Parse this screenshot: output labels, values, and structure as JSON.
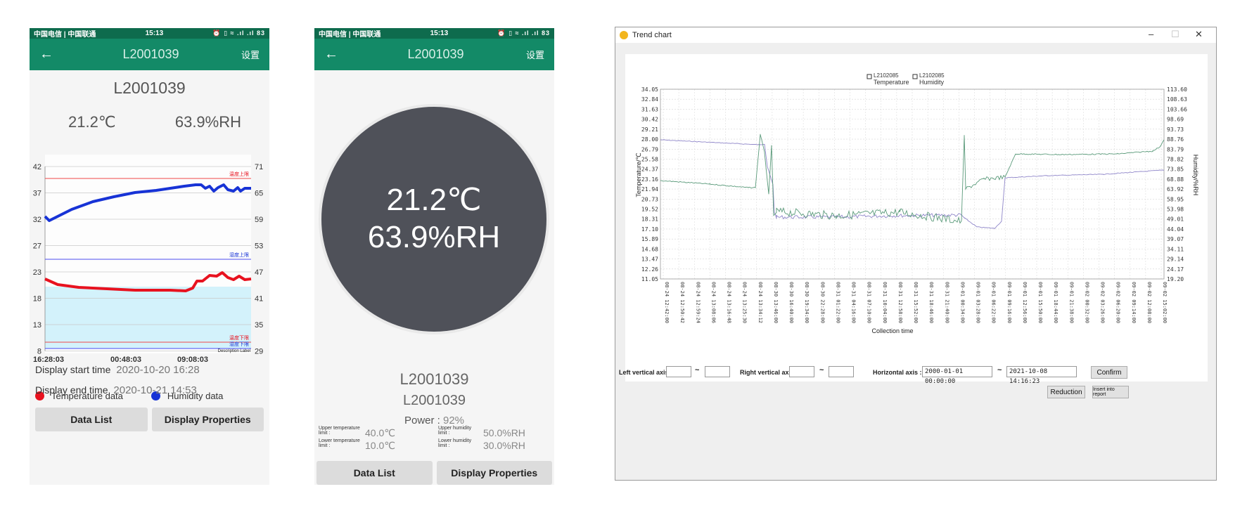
{
  "phone1": {
    "status": {
      "carrier": "中国电信 | 中国联通",
      "time": "15:13",
      "icons": "⏰ ▯ ≈ .ıl .ıl 83"
    },
    "app_bar": {
      "back": "←",
      "title": "L2001039",
      "settings": "设置"
    },
    "device_name": "L2001039",
    "temperature": "21.2℃",
    "humidity": "63.9%RH",
    "chart": {
      "left_ticks": [
        "42",
        "37",
        "32",
        "27",
        "23",
        "18",
        "13",
        "8"
      ],
      "right_ticks": [
        "71",
        "65",
        "59",
        "53",
        "47",
        "41",
        "35",
        "29"
      ],
      "x_ticks": [
        "16:28:03",
        "00:48:03",
        "09:08:03"
      ],
      "upper_temp_label": "温度上限",
      "upper_hum_label": "湿度上限",
      "lower_temp_label": "温度下限",
      "lower_hum_label": "湿度下限",
      "description_label": "Description Label",
      "temp_color": "#e8121f",
      "hum_color": "#1733d6"
    },
    "legend": {
      "temp": "Temperature data",
      "hum": "Humidity data"
    },
    "start_label": "Display start time",
    "start_value": "2020-10-20 16:28",
    "end_label": "Display end time",
    "end_value": "2020-10-21 14:53",
    "buttons": {
      "data_list": "Data List",
      "display_props": "Display Properties"
    }
  },
  "phone2": {
    "status": {
      "carrier": "中国电信 | 中国联通",
      "time": "15:13",
      "icons": "⏰ ▯ ≈ .ıl .ıl 83"
    },
    "app_bar": {
      "back": "←",
      "title": "L2001039",
      "settings": "设置"
    },
    "gauge_temp": "21.2℃",
    "gauge_hum": "63.9%RH",
    "name1": "L2001039",
    "name2": "L2001039",
    "power_label": "Power :",
    "power_value": "92%",
    "upper_temp_label": "Upper temperature limit :",
    "upper_temp_value": "40.0℃",
    "lower_temp_label": "Lower temperature limit :",
    "lower_temp_value": "10.0℃",
    "upper_hum_label": "Upper humidity limit :",
    "upper_hum_value": "50.0%RH",
    "lower_hum_label": "Lower humidity limit :",
    "lower_hum_value": "30.0%RH",
    "buttons": {
      "data_list": "Data List",
      "display_props": "Display Properties"
    }
  },
  "window": {
    "title": "Trend chart",
    "controls": {
      "min": "–",
      "max": "☐",
      "close": "✕"
    },
    "legend": [
      {
        "device": "L2102085",
        "label": "Temperature"
      },
      {
        "device": "L2102085",
        "label": "Humidity"
      }
    ],
    "y_left_label": "Temperature/℃",
    "y_right_label": "Humidity/%RH",
    "x_label": "Collection time",
    "left_ticks": [
      "34.05",
      "32.84",
      "31.63",
      "30.42",
      "29.21",
      "28.00",
      "26.79",
      "25.58",
      "24.37",
      "23.16",
      "21.94",
      "20.73",
      "19.52",
      "18.31",
      "17.10",
      "15.89",
      "14.68",
      "13.47",
      "12.26",
      "11.05"
    ],
    "right_ticks": [
      "113.60",
      "108.63",
      "103.66",
      "98.69",
      "93.73",
      "88.76",
      "83.79",
      "78.82",
      "73.85",
      "68.88",
      "63.92",
      "58.95",
      "53.98",
      "49.01",
      "44.04",
      "39.07",
      "34.11",
      "29.14",
      "24.17",
      "19.20"
    ],
    "x_ticks": [
      "08-24 12:42:00",
      "08-24 12:50:42",
      "08-24 12:59:24",
      "08-24 13:08:06",
      "08-24 13:16:48",
      "08-24 13:25:30",
      "08-24 13:34:12",
      "08-30 13:46:00",
      "08-30 16:40:00",
      "08-30 19:34:00",
      "08-30 22:28:00",
      "08-31 01:22:00",
      "08-31 04:16:00",
      "08-31 07:10:00",
      "08-31 10:04:00",
      "08-31 12:58:00",
      "08-31 15:52:00",
      "08-31 18:46:00",
      "08-31 21:40:00",
      "09-01 00:34:00",
      "09-01 03:28:00",
      "09-01 06:22:00",
      "09-01 09:16:00",
      "09-01 12:56:00",
      "09-01 15:50:00",
      "09-01 18:44:00",
      "09-01 21:38:00",
      "09-02 00:32:00",
      "09-02 03:26:00",
      "09-02 06:20:00",
      "09-02 09:14:00",
      "09-02 12:08:00",
      "09-02 15:02:00"
    ],
    "left_axis_label": "Left vertical axis :",
    "right_axis_label": "Right vertical axis :",
    "horizontal_axis_label": "Horizontal axis :",
    "left_min": "",
    "left_max": "",
    "right_min": "",
    "right_max": "",
    "h_start": "2000-01-01 00:00:00",
    "h_end": "2021-10-08 14:16:23",
    "tilde": "~",
    "confirm": "Confirm",
    "reduction": "Reduction",
    "insert": "Insert into report",
    "temp_color": "#5a9a7a",
    "hum_color": "#8f86c9"
  }
}
